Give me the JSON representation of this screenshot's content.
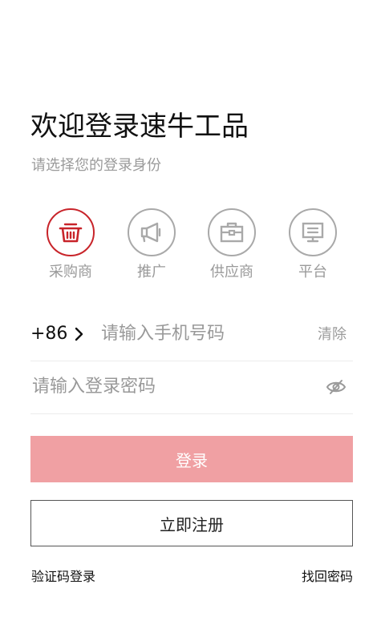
{
  "header": {
    "title": "欢迎登录速牛工品",
    "subtitle": "请选择您的登录身份"
  },
  "roles": {
    "selected": "采购商",
    "items": [
      {
        "label": "采购商",
        "icon": "basket-icon",
        "active": true
      },
      {
        "label": "推广",
        "icon": "megaphone-icon",
        "active": false
      },
      {
        "label": "供应商",
        "icon": "briefcase-icon",
        "active": false
      },
      {
        "label": "平台",
        "icon": "monitor-icon",
        "active": false
      }
    ]
  },
  "colors": {
    "accent": "#c8242a",
    "login_button": "#f0a0a3",
    "muted_text": "#9a9a9a"
  },
  "phone": {
    "country_code": "+86",
    "placeholder": "请输入手机号码",
    "value": "",
    "clear_label": "清除"
  },
  "password": {
    "placeholder": "请输入登录密码",
    "value": ""
  },
  "actions": {
    "login_label": "登录",
    "register_label": "立即注册",
    "sms_login_label": "验证码登录",
    "forgot_password_label": "找回密码"
  }
}
